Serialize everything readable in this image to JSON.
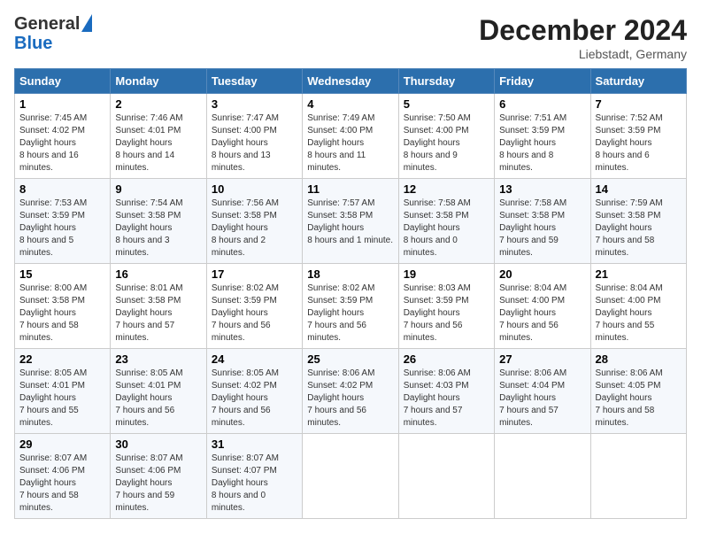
{
  "header": {
    "logo_general": "General",
    "logo_blue": "Blue",
    "month_title": "December 2024",
    "location": "Liebstadt, Germany"
  },
  "days_of_week": [
    "Sunday",
    "Monday",
    "Tuesday",
    "Wednesday",
    "Thursday",
    "Friday",
    "Saturday"
  ],
  "weeks": [
    [
      {
        "day": "1",
        "sunrise": "7:45 AM",
        "sunset": "4:02 PM",
        "daylight": "8 hours and 16 minutes."
      },
      {
        "day": "2",
        "sunrise": "7:46 AM",
        "sunset": "4:01 PM",
        "daylight": "8 hours and 14 minutes."
      },
      {
        "day": "3",
        "sunrise": "7:47 AM",
        "sunset": "4:00 PM",
        "daylight": "8 hours and 13 minutes."
      },
      {
        "day": "4",
        "sunrise": "7:49 AM",
        "sunset": "4:00 PM",
        "daylight": "8 hours and 11 minutes."
      },
      {
        "day": "5",
        "sunrise": "7:50 AM",
        "sunset": "4:00 PM",
        "daylight": "8 hours and 9 minutes."
      },
      {
        "day": "6",
        "sunrise": "7:51 AM",
        "sunset": "3:59 PM",
        "daylight": "8 hours and 8 minutes."
      },
      {
        "day": "7",
        "sunrise": "7:52 AM",
        "sunset": "3:59 PM",
        "daylight": "8 hours and 6 minutes."
      }
    ],
    [
      {
        "day": "8",
        "sunrise": "7:53 AM",
        "sunset": "3:59 PM",
        "daylight": "8 hours and 5 minutes."
      },
      {
        "day": "9",
        "sunrise": "7:54 AM",
        "sunset": "3:58 PM",
        "daylight": "8 hours and 3 minutes."
      },
      {
        "day": "10",
        "sunrise": "7:56 AM",
        "sunset": "3:58 PM",
        "daylight": "8 hours and 2 minutes."
      },
      {
        "day": "11",
        "sunrise": "7:57 AM",
        "sunset": "3:58 PM",
        "daylight": "8 hours and 1 minute."
      },
      {
        "day": "12",
        "sunrise": "7:58 AM",
        "sunset": "3:58 PM",
        "daylight": "8 hours and 0 minutes."
      },
      {
        "day": "13",
        "sunrise": "7:58 AM",
        "sunset": "3:58 PM",
        "daylight": "7 hours and 59 minutes."
      },
      {
        "day": "14",
        "sunrise": "7:59 AM",
        "sunset": "3:58 PM",
        "daylight": "7 hours and 58 minutes."
      }
    ],
    [
      {
        "day": "15",
        "sunrise": "8:00 AM",
        "sunset": "3:58 PM",
        "daylight": "7 hours and 58 minutes."
      },
      {
        "day": "16",
        "sunrise": "8:01 AM",
        "sunset": "3:58 PM",
        "daylight": "7 hours and 57 minutes."
      },
      {
        "day": "17",
        "sunrise": "8:02 AM",
        "sunset": "3:59 PM",
        "daylight": "7 hours and 56 minutes."
      },
      {
        "day": "18",
        "sunrise": "8:02 AM",
        "sunset": "3:59 PM",
        "daylight": "7 hours and 56 minutes."
      },
      {
        "day": "19",
        "sunrise": "8:03 AM",
        "sunset": "3:59 PM",
        "daylight": "7 hours and 56 minutes."
      },
      {
        "day": "20",
        "sunrise": "8:04 AM",
        "sunset": "4:00 PM",
        "daylight": "7 hours and 56 minutes."
      },
      {
        "day": "21",
        "sunrise": "8:04 AM",
        "sunset": "4:00 PM",
        "daylight": "7 hours and 55 minutes."
      }
    ],
    [
      {
        "day": "22",
        "sunrise": "8:05 AM",
        "sunset": "4:01 PM",
        "daylight": "7 hours and 55 minutes."
      },
      {
        "day": "23",
        "sunrise": "8:05 AM",
        "sunset": "4:01 PM",
        "daylight": "7 hours and 56 minutes."
      },
      {
        "day": "24",
        "sunrise": "8:05 AM",
        "sunset": "4:02 PM",
        "daylight": "7 hours and 56 minutes."
      },
      {
        "day": "25",
        "sunrise": "8:06 AM",
        "sunset": "4:02 PM",
        "daylight": "7 hours and 56 minutes."
      },
      {
        "day": "26",
        "sunrise": "8:06 AM",
        "sunset": "4:03 PM",
        "daylight": "7 hours and 57 minutes."
      },
      {
        "day": "27",
        "sunrise": "8:06 AM",
        "sunset": "4:04 PM",
        "daylight": "7 hours and 57 minutes."
      },
      {
        "day": "28",
        "sunrise": "8:06 AM",
        "sunset": "4:05 PM",
        "daylight": "7 hours and 58 minutes."
      }
    ],
    [
      {
        "day": "29",
        "sunrise": "8:07 AM",
        "sunset": "4:06 PM",
        "daylight": "7 hours and 58 minutes."
      },
      {
        "day": "30",
        "sunrise": "8:07 AM",
        "sunset": "4:06 PM",
        "daylight": "7 hours and 59 minutes."
      },
      {
        "day": "31",
        "sunrise": "8:07 AM",
        "sunset": "4:07 PM",
        "daylight": "8 hours and 0 minutes."
      },
      null,
      null,
      null,
      null
    ]
  ],
  "labels": {
    "sunrise": "Sunrise:",
    "sunset": "Sunset:",
    "daylight": "Daylight hours"
  }
}
